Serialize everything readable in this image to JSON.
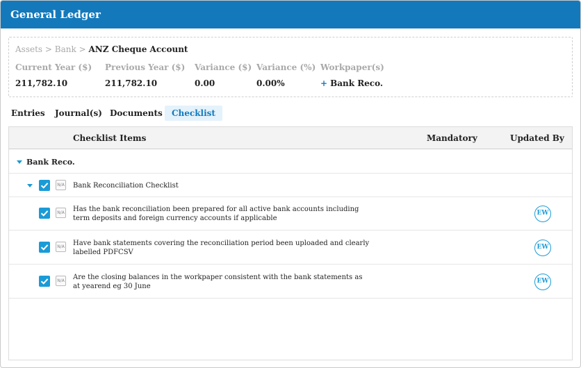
{
  "window": {
    "title": "General Ledger"
  },
  "breadcrumb": {
    "level1": "Assets",
    "level2": "Bank",
    "separator": ">",
    "current": "ANZ Cheque Account"
  },
  "summary": {
    "current_year_label": "Current Year ($)",
    "current_year_value": "211,782.10",
    "previous_year_label": "Previous Year ($)",
    "previous_year_value": "211,782.10",
    "variance_label": "Variance ($)",
    "variance_value": "0.00",
    "variance_pct_label": "Variance (%)",
    "variance_pct_value": "0.00%",
    "workpapers_label": "Workpaper(s)",
    "workpaper_add": "+",
    "workpaper_value": "Bank Reco."
  },
  "tabs": [
    "Entries",
    "Journal(s)",
    "Documents",
    "Checklist"
  ],
  "active_tab": "Checklist",
  "grid": {
    "headers": {
      "items": "Checklist Items",
      "mandatory": "Mandatory",
      "updated_by": "Updated By"
    },
    "group": {
      "label": "Bank Reco."
    },
    "parent": {
      "na": "N/A",
      "label": "Bank Reconciliation Checklist"
    },
    "items": [
      {
        "na": "N/A",
        "line1": "Has the bank reconciliation been prepared for all active bank accounts including",
        "line2": "term deposits and foreign currency accounts if applicable",
        "updated_by": "EW"
      },
      {
        "na": "N/A",
        "line1": "Have bank statements covering the reconciliation period been uploaded and clearly",
        "line2": "labelled PDFCSV",
        "updated_by": "EW"
      },
      {
        "na": "N/A",
        "line1": "Are the closing balances in the workpaper consistent with the bank statements as",
        "line2": "at yearend eg 30 June",
        "updated_by": "EW"
      }
    ]
  },
  "colors": {
    "accent": "#1479bb",
    "check": "#1a9bd7",
    "muted": "#a9a9a9"
  }
}
